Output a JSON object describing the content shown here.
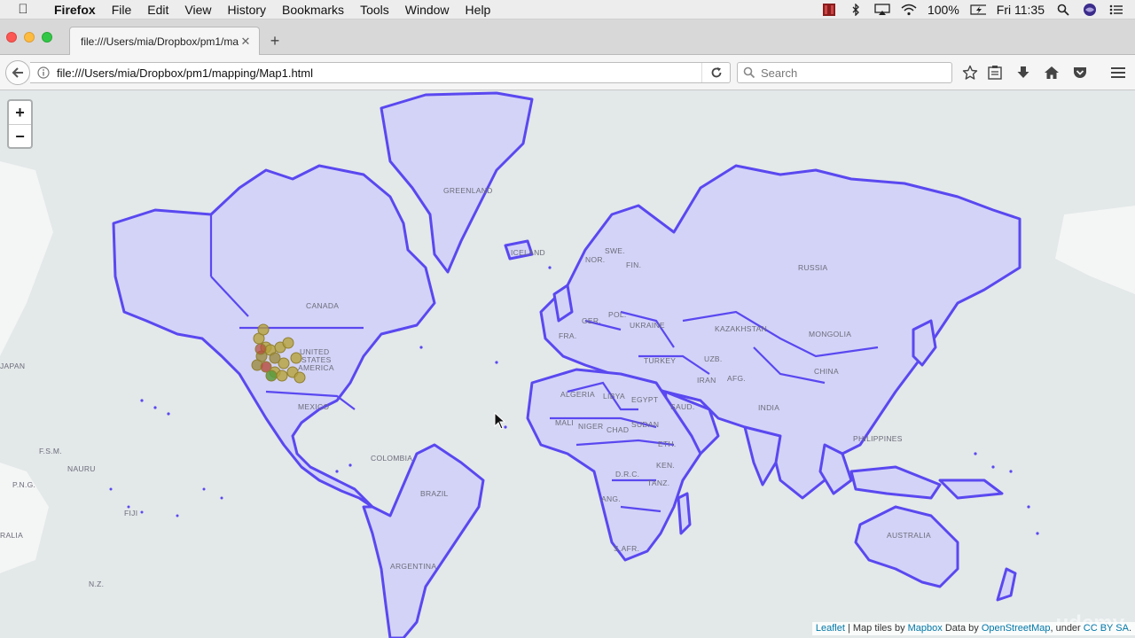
{
  "menubar": {
    "app": "Firefox",
    "items": [
      "File",
      "Edit",
      "View",
      "History",
      "Bookmarks",
      "Tools",
      "Window",
      "Help"
    ],
    "battery": "100%",
    "clock": "Fri 11:35"
  },
  "tab": {
    "title": "file:///Users/mia/Dropbox/pm1/ma"
  },
  "navbar": {
    "url": "file:///Users/mia/Dropbox/pm1/mapping/Map1.html",
    "search_placeholder": "Search"
  },
  "map": {
    "zoom_in": "+",
    "zoom_out": "−",
    "labels": {
      "greenland": "GREENLAND",
      "canada": "CANADA",
      "usa1": "UNITED",
      "usa2": "STATES",
      "usa3": "AMERICA",
      "mexico": "MEXICO",
      "brazil": "BRAZIL",
      "colombia": "COLOMBIA",
      "argentina": "ARGENTINA",
      "russia": "RUSSIA",
      "kazakhstan": "KAZAKHSTAN",
      "mongolia": "MONGOLIA",
      "china": "CHINA",
      "india": "INDIA",
      "iran": "IRAN",
      "turkey": "TURKEY",
      "ukraine": "UKRAINE",
      "pol": "POL.",
      "fin": "FIN.",
      "swe": "SWE.",
      "nor": "NOR.",
      "algeria": "ALGERIA",
      "libya": "LIBYA",
      "egypt": "EGYPT",
      "mali": "MALI",
      "niger": "NIGER",
      "chad": "CHAD",
      "sudan": "SUDAN",
      "drc": "D.R.C.",
      "ang": "ANG.",
      "safr": "S.AFR.",
      "saud": "SAUD.",
      "afg": "AFG.",
      "uzb": "UZB.",
      "eth": "ETH.",
      "ken": "KEN.",
      "tanz": "TANZ.",
      "philippines": "PHILIPPINES",
      "australia": "AUSTRALIA",
      "japan": "JAPAN",
      "nauru": "NAURU",
      "fsm": "F.S.M.",
      "png": "P.N.G.",
      "fiji": "FIJI",
      "nz": "N.Z.",
      "ralia": "RALIA",
      "iceland": "ICELAND",
      "ger": "GER.",
      "fra": "FRA."
    },
    "markers_desc_colors": [
      "#b5a33a",
      "#9c8b3f",
      "#5a9a3c",
      "#b44a3a"
    ]
  },
  "attribution": {
    "leaflet": "Leaflet",
    "sep1": " | Map tiles by ",
    "mapbox": "Mapbox",
    "sep2": " Data by ",
    "osm": "OpenStreetMap",
    "sep3": ", under ",
    "cc": "CC BY SA",
    "end": "."
  },
  "watermark": "udemy"
}
